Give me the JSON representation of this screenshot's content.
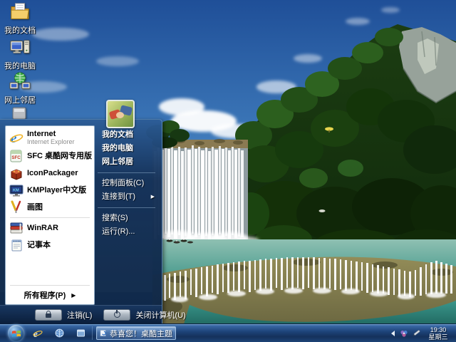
{
  "desktop": {
    "icons": [
      {
        "label": "我的文档"
      },
      {
        "label": "我的电脑"
      },
      {
        "label": "网上邻居"
      }
    ]
  },
  "start_menu": {
    "left_items": [
      {
        "label": "Internet",
        "sublabel": "Internet Explorer"
      },
      {
        "label": "SFC 桌酷网专用版"
      },
      {
        "label": "IconPackager"
      },
      {
        "label": "KMPlayer中文版"
      },
      {
        "label": "画图"
      },
      {
        "label": "WinRAR"
      },
      {
        "label": "记事本"
      }
    ],
    "all_programs_label": "所有程序(P)",
    "all_programs_arrow": "▶",
    "right_items": [
      "我的文档",
      "我的电脑",
      "网上邻居",
      "控制面板(C)",
      "连接到(T)",
      "搜索(S)",
      "运行(R)..."
    ],
    "connect_to_arrow": "▶",
    "logoff_label": "注销(L)",
    "shutdown_label": "关闭计算机(U)"
  },
  "taskbar": {
    "task_button_label": "恭喜您！桌酷主题...",
    "clock_time": "19:30",
    "clock_day": "星期三"
  },
  "icons": {
    "start_orb": "windows-flag-orb",
    "quick_launch": [
      "internet-explorer-icon",
      "globe-icon",
      "window-icon"
    ],
    "tray": [
      "collapse-arrow-icon",
      "theme-flower-icon",
      "pen-icon"
    ],
    "menu_buttons": [
      "lock-icon",
      "power-icon"
    ]
  },
  "colors": {
    "menu_frame": "#1c4474",
    "taskbar_top": "#7ea9d6",
    "taskbar_bottom": "#14315a",
    "pool_teal": "#2e8c82",
    "sky_top": "#2b5ea7"
  }
}
